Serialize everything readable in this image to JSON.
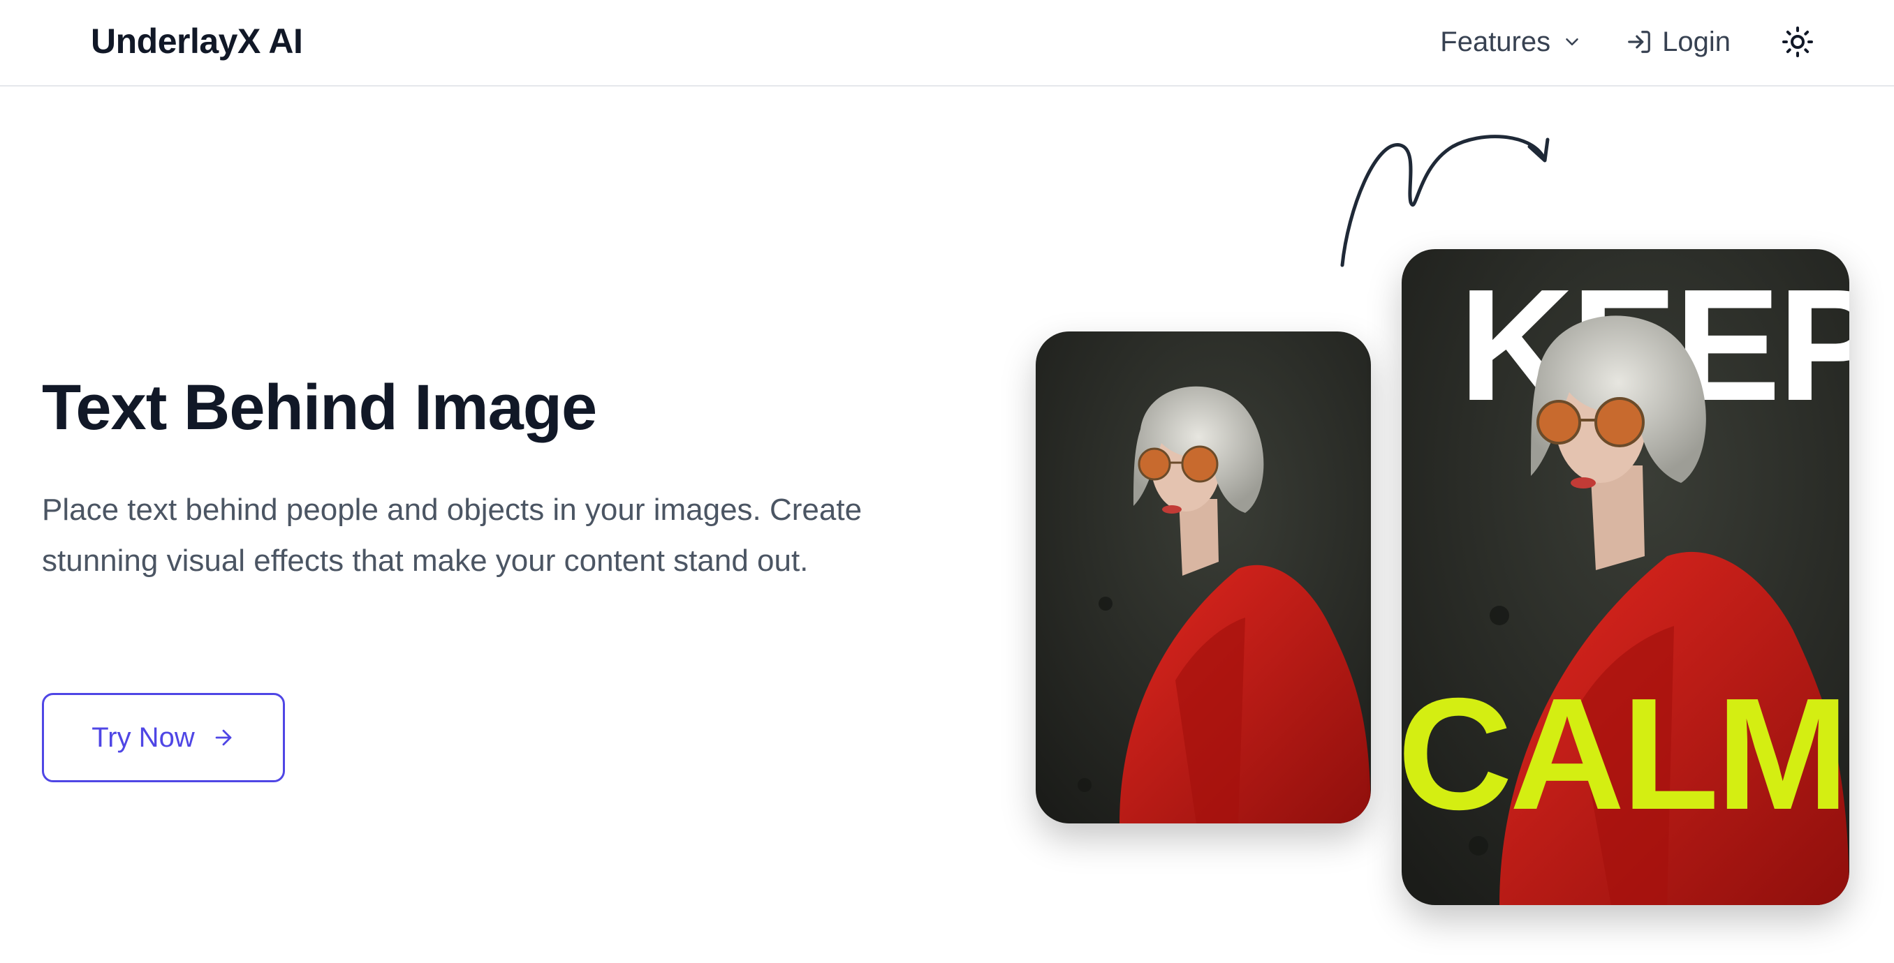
{
  "header": {
    "brand": "UnderlayX AI",
    "nav": {
      "features_label": "Features",
      "login_label": "Login"
    }
  },
  "hero": {
    "title": "Text Behind Image",
    "description": "Place text behind people and objects in your images. Create stunning visual effects that make your content stand out.",
    "cta_label": "Try Now"
  },
  "showcase": {
    "top_text": "KEEP",
    "bottom_text": "CALM"
  },
  "icons": {
    "features_dropdown": "chevron-down-icon",
    "login": "login-arrow-icon",
    "theme": "sun-icon",
    "cta": "arrow-right-icon",
    "decoration": "curly-arrow-icon"
  },
  "colors": {
    "accent": "#4f46e5",
    "title": "#111827",
    "body_text": "#4b5563",
    "nav_text": "#374151",
    "calm_text": "#d4ee12",
    "keep_text": "#ffffff"
  }
}
